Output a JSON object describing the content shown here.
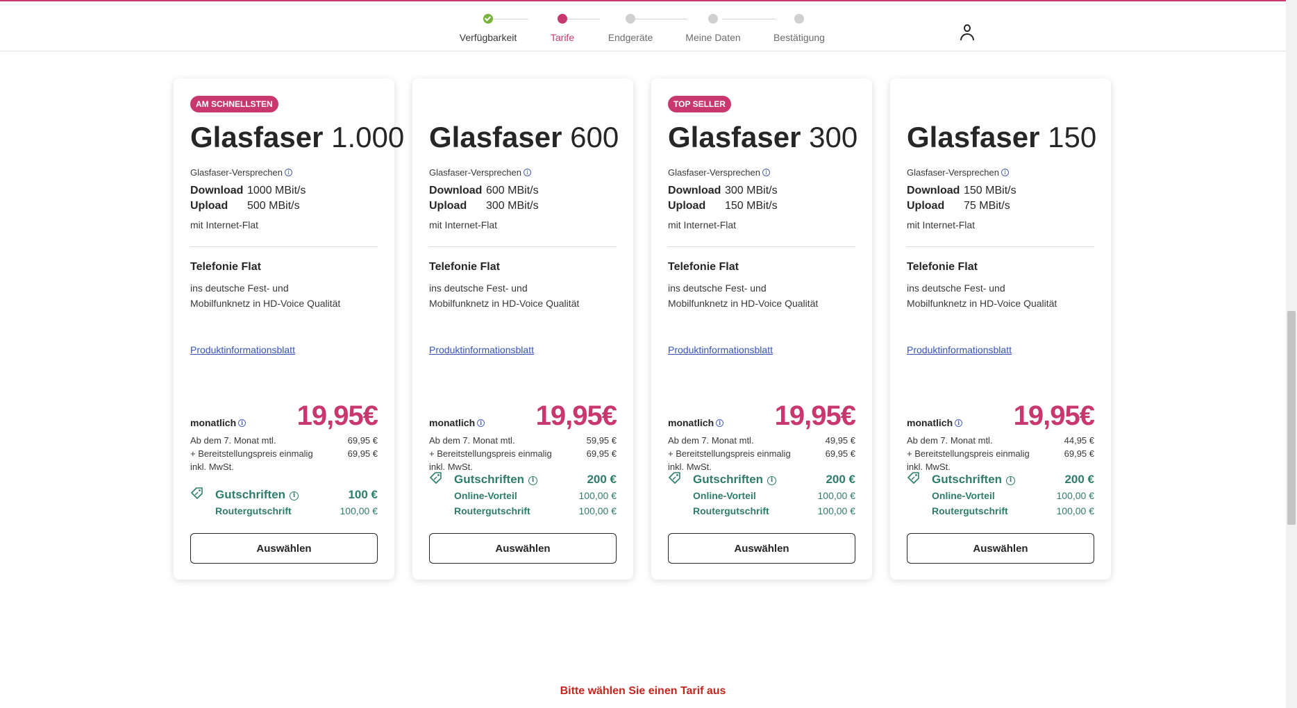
{
  "stepper": {
    "steps": [
      {
        "label": "Verfügbarkeit",
        "state": "done"
      },
      {
        "label": "Tarife",
        "state": "active"
      },
      {
        "label": "Endgeräte",
        "state": "pending"
      },
      {
        "label": "Meine Daten",
        "state": "pending"
      },
      {
        "label": "Bestätigung",
        "state": "pending"
      }
    ]
  },
  "header": {
    "user_icon": "user-icon"
  },
  "colors": {
    "brand": "#c8386e",
    "credit": "#2e7d6b",
    "link": "#3453b9",
    "error": "#c4261d",
    "done": "#79b33b"
  },
  "common": {
    "promise_label": "Glasfaser-Versprechen",
    "download_label": "Download",
    "upload_label": "Upload",
    "flat_label": "mit Internet-Flat",
    "tel_title": "Telefonie Flat",
    "tel_line1": "ins deutsche Fest- und",
    "tel_line2": "Mobilfunknetz in HD-Voice Qualität",
    "pib_link": "Produktinformationsblatt",
    "monthly_label": "monatlich",
    "after_label": "Ab dem 7. Monat mtl.",
    "setup_label": "+ Bereitstellungspreis einmalig",
    "vat_label": "inkl. MwSt.",
    "credits_label": "Gutschriften",
    "online_label": "Online-Vorteil",
    "router_label": "Routergutschrift",
    "select_button": "Auswählen"
  },
  "tariffs": [
    {
      "badge": "AM SCHNELLSTEN",
      "name": "Glasfaser",
      "speed": "1.000",
      "download": "1000 MBit/s",
      "upload": "500 MBit/s",
      "price": "19,95€",
      "after_price": "69,95 €",
      "setup_price": "69,95 €",
      "credits_total": "100 €",
      "online": null,
      "router": "100,00 €"
    },
    {
      "badge": "",
      "name": "Glasfaser",
      "speed": "600",
      "download": "600 MBit/s",
      "upload": "300 MBit/s",
      "price": "19,95€",
      "after_price": "59,95 €",
      "setup_price": "69,95 €",
      "credits_total": "200 €",
      "online": "100,00 €",
      "router": "100,00 €"
    },
    {
      "badge": "TOP SELLER",
      "name": "Glasfaser",
      "speed": "300",
      "download": "300 MBit/s",
      "upload": "150 MBit/s",
      "price": "19,95€",
      "after_price": "49,95 €",
      "setup_price": "69,95 €",
      "credits_total": "200 €",
      "online": "100,00 €",
      "router": "100,00 €"
    },
    {
      "badge": "",
      "name": "Glasfaser",
      "speed": "150",
      "download": "150 MBit/s",
      "upload": "75 MBit/s",
      "price": "19,95€",
      "after_price": "44,95 €",
      "setup_price": "69,95 €",
      "credits_total": "200 €",
      "online": "100,00 €",
      "router": "100,00 €"
    }
  ],
  "footer": {
    "message": "Bitte wählen Sie einen Tarif aus"
  }
}
